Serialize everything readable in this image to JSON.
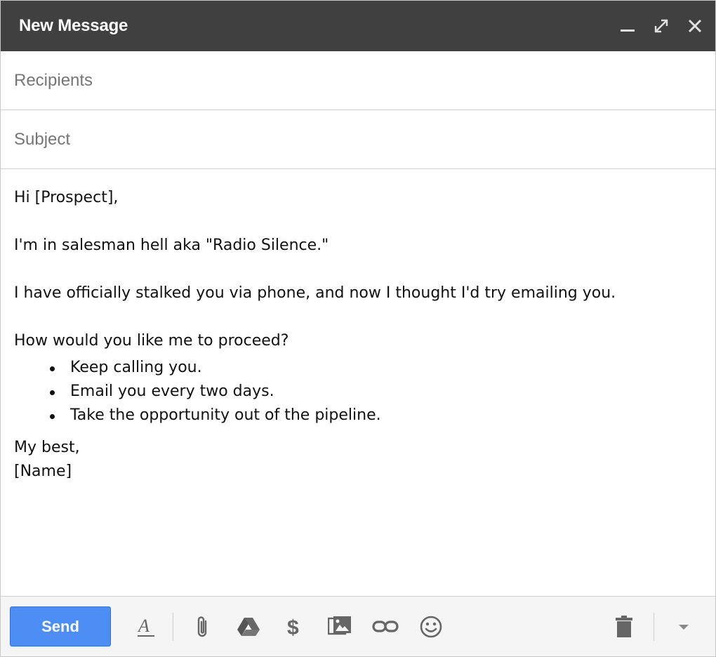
{
  "window": {
    "title": "New Message",
    "controls": [
      "minimize-icon",
      "expand-icon",
      "close-icon"
    ]
  },
  "recipients": {
    "placeholder": "Recipients",
    "value": ""
  },
  "subject": {
    "placeholder": "Subject",
    "value": ""
  },
  "message": {
    "greeting": "Hi [Prospect],",
    "line1": "I'm in salesman hell aka \"Radio Silence.\"",
    "line2": "I have officially stalked you via phone, and now I thought I'd try emailing you.",
    "line3": "How would you like me to proceed?",
    "options": [
      "Keep calling you.",
      "Email you every two days.",
      "Take the opportunity out of the pipeline."
    ],
    "closing": "My best,",
    "signature": "[Name]"
  },
  "toolbar": {
    "send_label": "Send",
    "send_color": "#4d8ef5",
    "icons": [
      "text-format-icon",
      "attach-icon",
      "drive-icon",
      "money-icon",
      "photo-icon",
      "link-icon",
      "emoji-icon",
      "trash-icon",
      "more-options-icon"
    ]
  },
  "colors": {
    "titlebar": "#404040",
    "icon": "#666666"
  }
}
